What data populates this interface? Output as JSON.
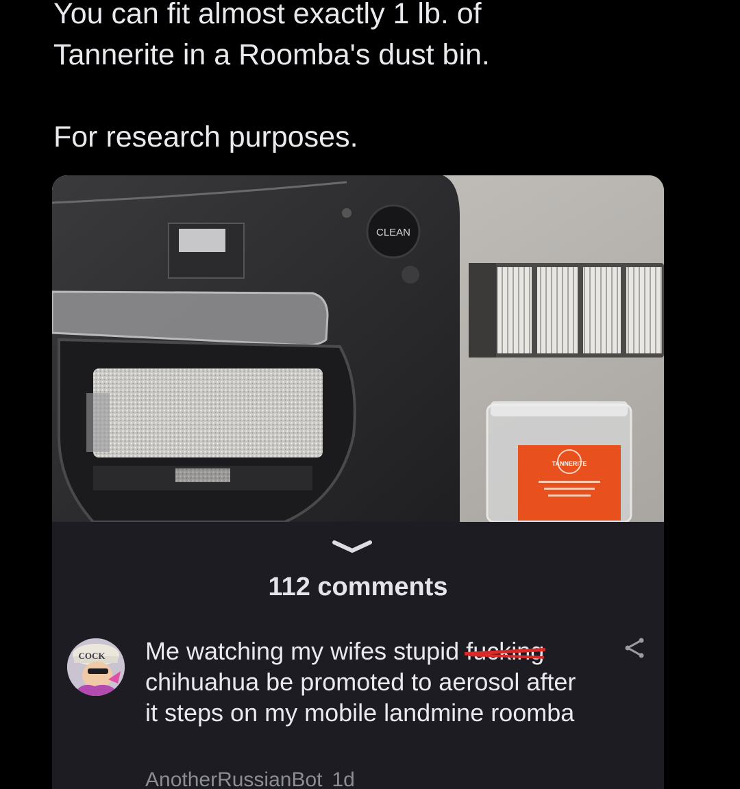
{
  "post": {
    "line1": "You can fit almost exactly 1 lb. of",
    "line2": "Tannerite in a Roomba's dust bin.",
    "line3": "For research purposes."
  },
  "photo": {
    "clean_button_label": "CLEAN",
    "jar_label_text": "TANNERITE"
  },
  "comments": {
    "count_label": "112 comments"
  },
  "comment": {
    "avatar_text": "COCK",
    "text_before_strike": "Me watching my wifes stupid ",
    "struck_word": "fucking",
    "text_after_strike": "chihuahua be promoted to aerosol after it steps on my mobile landmine roomba",
    "author": "AnotherRussianBot",
    "age": "1d"
  },
  "icons": {
    "collapse": "chevron-down-icon",
    "share": "share-icon"
  },
  "colors": {
    "background": "#000000",
    "panel": "#1c1c22",
    "text": "#e9e9ee",
    "meta": "#8c8c95",
    "strike": "#d92a2a",
    "jar_label": "#e8501e"
  }
}
